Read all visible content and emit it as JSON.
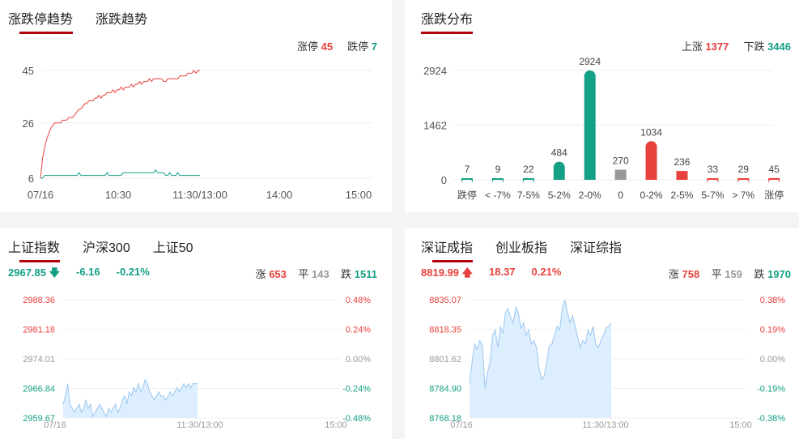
{
  "panel_limit": {
    "tabs": [
      "涨跌停趋势",
      "涨跌趋势"
    ],
    "limit_up_label": "涨停",
    "limit_up_count": "45",
    "limit_down_label": "跌停",
    "limit_down_count": "7"
  },
  "panel_dist": {
    "tabs": [
      "涨跌分布"
    ],
    "up_label": "上涨",
    "up_count": "1377",
    "down_label": "下跌",
    "down_count": "3446"
  },
  "panel_sh": {
    "tabs": [
      "上证指数",
      "沪深300",
      "上证50"
    ],
    "price": "2967.85",
    "change": "-6.16",
    "pct": "-0.21%",
    "up_label": "涨",
    "up": "653",
    "flat_label": "平",
    "flat": "143",
    "down_label": "跌",
    "down": "1511"
  },
  "panel_sz": {
    "tabs": [
      "深证成指",
      "创业板指",
      "深证综指"
    ],
    "price": "8819.99",
    "change": "18.37",
    "pct": "0.21%",
    "up_label": "涨",
    "up": "758",
    "flat_label": "平",
    "flat": "159",
    "down_label": "跌",
    "down": "1970"
  },
  "colors": {
    "red": "#e8413e",
    "green": "#14a085",
    "gray": "#999999",
    "accent": "#b3000a",
    "area": "#ddeeff",
    "area_line": "#9cc8f0"
  },
  "chart_data": [
    {
      "type": "line",
      "ylim": [
        6,
        45
      ],
      "y_ticks": [
        "45",
        "26",
        "6"
      ],
      "x_ticks": [
        "07/16",
        "10:30",
        "11:30/13:00",
        "14:00",
        "15:00"
      ],
      "series": [
        {
          "name": "涨停",
          "color": "#e8413e",
          "values": [
            6,
            13,
            17,
            20,
            22,
            24,
            25,
            26,
            26,
            26,
            26,
            27,
            27,
            27,
            28,
            28,
            28,
            29,
            30,
            31,
            31,
            32,
            33,
            33,
            34,
            34,
            34,
            35,
            35,
            36,
            35,
            36,
            36,
            37,
            37,
            37,
            38,
            37,
            38,
            38,
            39,
            38,
            39,
            39,
            39,
            40,
            39,
            40,
            40,
            41,
            40,
            41,
            41,
            41,
            42,
            41,
            42,
            42,
            42,
            42,
            42,
            41,
            41,
            42,
            42,
            42,
            42,
            42,
            42,
            43,
            43,
            43,
            43,
            44,
            44,
            44,
            45,
            44,
            45,
            45
          ]
        },
        {
          "name": "跌停",
          "color": "#14a085",
          "values": [
            6,
            6,
            7,
            7,
            7,
            7,
            7,
            7,
            7,
            7,
            7,
            7,
            7,
            7,
            7,
            7,
            7,
            7,
            7,
            8,
            7,
            7,
            7,
            7,
            7,
            7,
            7,
            7,
            7,
            7,
            7,
            7,
            7,
            8,
            7,
            7,
            7,
            7,
            7,
            7,
            7,
            8,
            8,
            8,
            8,
            8,
            8,
            8,
            8,
            8,
            8,
            8,
            8,
            8,
            8,
            8,
            8,
            9,
            8,
            8,
            8,
            8,
            7,
            7,
            8,
            7,
            7,
            7,
            8,
            7,
            7,
            7,
            7,
            7,
            7,
            7,
            7,
            7,
            7,
            7
          ]
        }
      ]
    },
    {
      "type": "bar",
      "ylim": [
        0,
        2924
      ],
      "y_ticks": [
        "2924",
        "1462",
        "0"
      ],
      "categories": [
        "跌停",
        "< -7%",
        "7-5%",
        "5-2%",
        "2-0%",
        "0",
        "0-2%",
        "2-5%",
        "5-7%",
        "> 7%",
        "涨停"
      ],
      "values": [
        7,
        9,
        22,
        484,
        2924,
        270,
        1034,
        236,
        33,
        29,
        45
      ],
      "labels": [
        "7",
        "9",
        "22",
        "484",
        "2924",
        "270",
        "1034",
        "236",
        "33",
        "29",
        "45"
      ],
      "colors": [
        "#14a085",
        "#14a085",
        "#14a085",
        "#14a085",
        "#14a085",
        "#999999",
        "#e8413e",
        "#e8413e",
        "#e8413e",
        "#e8413e",
        "#e8413e"
      ]
    },
    {
      "type": "area",
      "ylim": [
        2959.67,
        2988.36
      ],
      "y_ticks": [
        "2988.36",
        "2981.18",
        "2974.01",
        "2966.84",
        "2959.67"
      ],
      "y_ticks_right": [
        "0.48%",
        "0.24%",
        "0.00%",
        "-0.24%",
        "-0.48%"
      ],
      "x_ticks": [
        "07/16",
        "11:30/13:00",
        "15:00"
      ],
      "values": [
        2963,
        2965,
        2968,
        2963,
        2962,
        2961,
        2962,
        2963,
        2961,
        2962,
        2964,
        2962,
        2963,
        2960,
        2961,
        2962,
        2963,
        2962,
        2961,
        2960,
        2962,
        2961,
        2962,
        2963,
        2961,
        2962,
        2964,
        2965,
        2963,
        2966,
        2965,
        2967,
        2966,
        2968,
        2966,
        2967,
        2969,
        2968,
        2966,
        2965,
        2964,
        2965,
        2966,
        2965,
        2965,
        2964,
        2965,
        2966,
        2965,
        2966,
        2967,
        2966,
        2967,
        2968,
        2967,
        2968,
        2967,
        2968,
        2968,
        2968
      ]
    },
    {
      "type": "area",
      "ylim": [
        8768.18,
        8835.07
      ],
      "y_ticks": [
        "8835.07",
        "8818.35",
        "8801.62",
        "8784.90",
        "8768.18"
      ],
      "y_ticks_right": [
        "0.38%",
        "0.19%",
        "0.00%",
        "-0.19%",
        "-0.38%"
      ],
      "x_ticks": [
        "07/16",
        "11:30/13:00",
        "15:00"
      ],
      "values": [
        8788,
        8800,
        8810,
        8807,
        8812,
        8809,
        8785,
        8794,
        8800,
        8815,
        8818,
        8808,
        8820,
        8816,
        8828,
        8830,
        8825,
        8822,
        8831,
        8827,
        8819,
        8822,
        8815,
        8818,
        8810,
        8812,
        8808,
        8796,
        8790,
        8792,
        8800,
        8809,
        8810,
        8815,
        8820,
        8818,
        8830,
        8835,
        8828,
        8822,
        8826,
        8820,
        8814,
        8808,
        8812,
        8810,
        8818,
        8815,
        8820,
        8810,
        8808,
        8812,
        8815,
        8819,
        8820,
        8822
      ]
    }
  ]
}
